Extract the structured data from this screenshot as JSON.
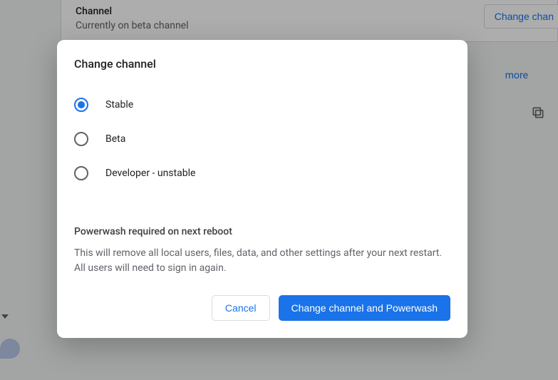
{
  "background": {
    "section_title": "Channel",
    "section_sub": "Currently on beta channel",
    "change_button": "Change chan",
    "more_link": "more"
  },
  "dialog": {
    "title": "Change channel",
    "options": {
      "stable": "Stable",
      "beta": "Beta",
      "developer": "Developer - unstable"
    },
    "selected": "stable",
    "warning_title": "Powerwash required on next reboot",
    "warning_body": "This will remove all local users, files, data, and other settings after your next restart. All users will need to sign in again.",
    "cancel": "Cancel",
    "confirm": "Change channel and Powerwash"
  }
}
